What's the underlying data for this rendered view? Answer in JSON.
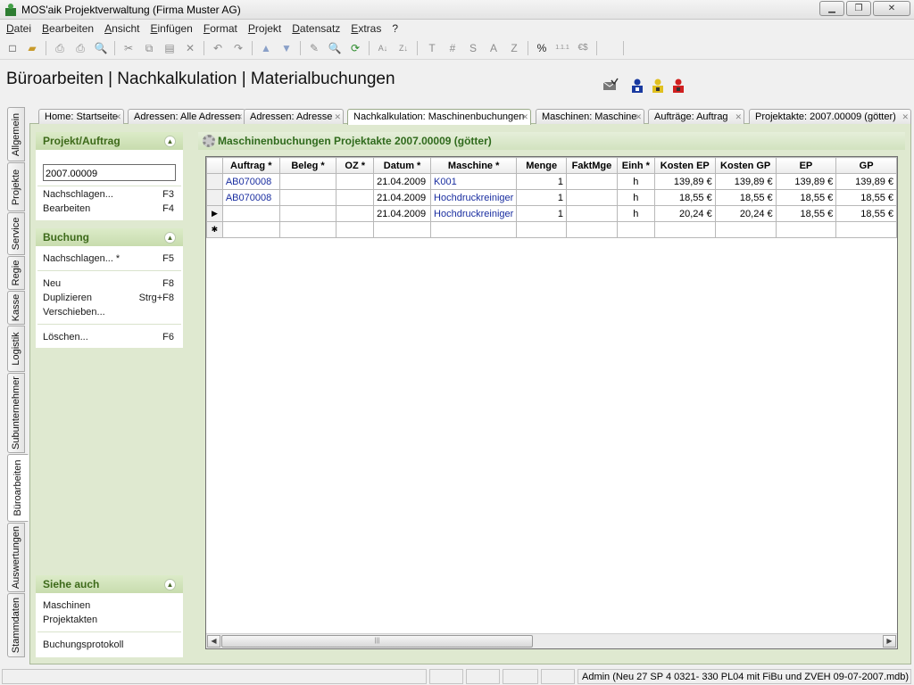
{
  "window": {
    "title": "MOS'aik Projektverwaltung (Firma Muster AG)",
    "minimize": "▁",
    "restore": "❐",
    "close": "✕"
  },
  "menu": [
    "Datei",
    "Bearbeiten",
    "Ansicht",
    "Einfügen",
    "Format",
    "Projekt",
    "Datensatz",
    "Extras",
    "?"
  ],
  "toolbar": {
    "new_icon": "□",
    "open_icon": "▰",
    "print_icon": "⎙",
    "cut_icon": "✂",
    "copy_icon": "⧉",
    "paste_icon": "▤",
    "delete_icon": "✕",
    "undo_icon": "↶",
    "redo_icon": "↷",
    "up_icon": "▲",
    "down_icon": "▼",
    "edit_icon": "✎",
    "search_icon": "🔍",
    "refresh_icon": "⟳",
    "sort_asc": "A↓",
    "sort_desc": "Z↓",
    "t_label": "T",
    "hash_label": "#",
    "s_label": "S",
    "a_label": "A",
    "z_label": "Z",
    "percent_label": "%",
    "num_format_label": "1.1.1",
    "currency_label": "€$"
  },
  "page": {
    "title": "Büroarbeiten | Nachkalkulation | Materialbuchungen"
  },
  "left_tabs": [
    "Allgemein",
    "Projekte",
    "Service",
    "Regie",
    "Kasse",
    "Logistik",
    "Subunternehmer",
    "Büroarbeiten",
    "Auswertungen",
    "Stammdaten"
  ],
  "top_tabs": [
    "Home: Startseite",
    "Adressen: Alle Adressen",
    "Adressen: Adresse",
    "Nachkalkulation: Maschinenbuchungen",
    "Maschinen: Maschine",
    "Aufträge: Auftrag",
    "Projektakte: 2007.00009 (götter)"
  ],
  "panel_projekt": {
    "title": "Projekt/Auftrag",
    "input_value": "2007.00009",
    "nachschlagen": "Nachschlagen...",
    "nachschlagen_key": "F3",
    "bearbeiten": "Bearbeiten",
    "bearbeiten_key": "F4"
  },
  "panel_buchung": {
    "title": "Buchung",
    "nachschlagen": "Nachschlagen... *",
    "nachschlagen_key": "F5",
    "neu": "Neu",
    "neu_key": "F8",
    "duplizieren": "Duplizieren",
    "duplizieren_key": "Strg+F8",
    "verschieben": "Verschieben...",
    "loeschen": "Löschen...",
    "loeschen_key": "F6"
  },
  "panel_siehe": {
    "title": "Siehe auch",
    "maschinen": "Maschinen",
    "projektakten": "Projektakten",
    "buchungsprotokoll": "Buchungsprotokoll"
  },
  "content": {
    "title": "Maschinenbuchungen Projektakte 2007.00009 (götter)"
  },
  "grid": {
    "columns": [
      "Auftrag *",
      "Beleg *",
      "OZ *",
      "Datum *",
      "Maschine *",
      "Menge",
      "FaktMge",
      "Einh *",
      "Kosten EP",
      "Kosten GP",
      "EP",
      "GP"
    ],
    "rows": [
      [
        "AB070008",
        "",
        "",
        "21.04.2009",
        "K001",
        "1",
        "",
        "h",
        "139,89 €",
        "139,89 €",
        "139,89 €",
        "139,89 €"
      ],
      [
        "AB070008",
        "",
        "",
        "21.04.2009",
        "Hochdruckreiniger",
        "1",
        "",
        "h",
        "18,55 €",
        "18,55 €",
        "18,55 €",
        "18,55 €"
      ],
      [
        "",
        "",
        "",
        "21.04.2009",
        "Hochdruckreiniger",
        "1",
        "",
        "h",
        "20,24 €",
        "20,24 €",
        "18,55 €",
        "18,55 €"
      ]
    ],
    "current_row_marker": "▶",
    "new_row_marker": "✱"
  },
  "status": {
    "text": "Admin (Neu 27 SP 4 0321- 330 PL04 mit FiBu und ZVEH 09-07-2007.mdb)"
  }
}
